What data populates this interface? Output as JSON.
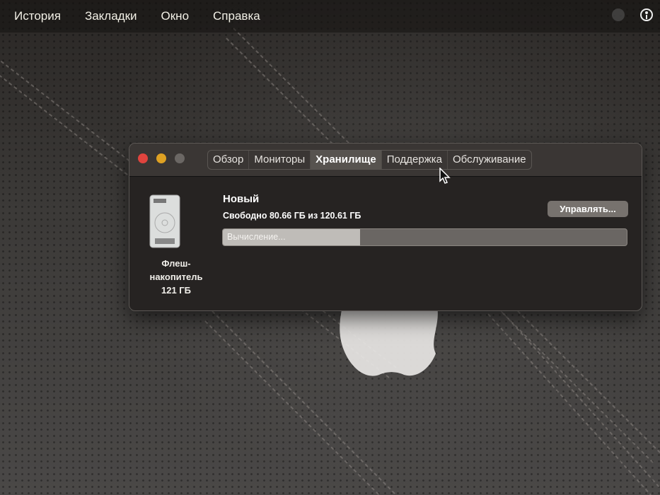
{
  "menubar": {
    "items": [
      "История",
      "Закладки",
      "Окно",
      "Справка"
    ],
    "status_icons": [
      "globe-icon",
      "accessibility-icon"
    ]
  },
  "window": {
    "tabs": [
      {
        "label": "Обзор",
        "active": false
      },
      {
        "label": "Мониторы",
        "active": false
      },
      {
        "label": "Хранилище",
        "active": true
      },
      {
        "label": "Поддержка",
        "active": false
      },
      {
        "label": "Обслуживание",
        "active": false
      }
    ],
    "disk": {
      "icon": "hard-drive-icon",
      "label_line1": "Флеш-",
      "label_line2": "накопитель",
      "label_line3": "121 ГБ"
    },
    "volume": {
      "name": "Новый",
      "free_text": "Свободно 80.66 ГБ из 120.61 ГБ",
      "usage_fraction": 0.34,
      "bar_text": "Вычисление..."
    },
    "manage_button": "Управлять..."
  },
  "colors": {
    "close": "#e0443e",
    "minimize": "#dea123",
    "zoom_disabled": "#6b6764"
  }
}
